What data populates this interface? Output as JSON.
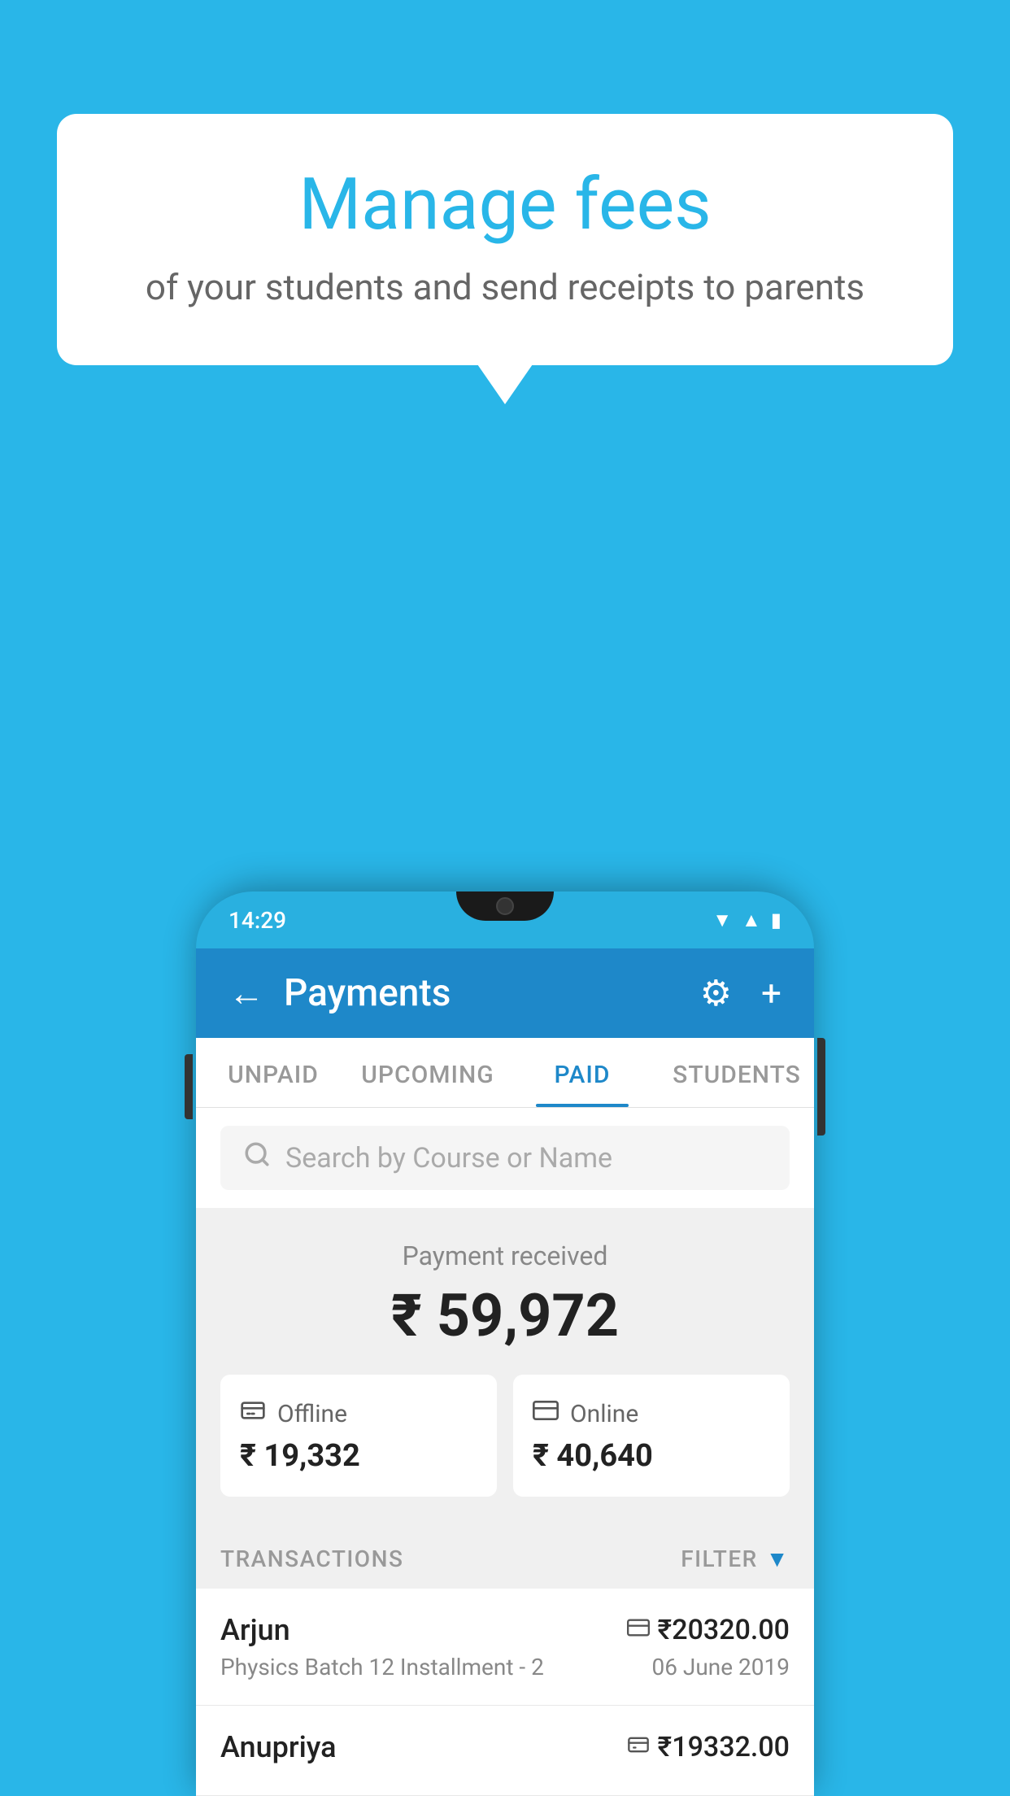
{
  "background_color": "#29b6e8",
  "bubble": {
    "title": "Manage fees",
    "subtitle": "of your students and send receipts to parents"
  },
  "phone": {
    "status_bar": {
      "time": "14:29"
    },
    "header": {
      "title": "Payments",
      "back_label": "←",
      "settings_icon": "⚙",
      "add_icon": "+"
    },
    "tabs": [
      {
        "label": "UNPAID",
        "active": false
      },
      {
        "label": "UPCOMING",
        "active": false
      },
      {
        "label": "PAID",
        "active": true
      },
      {
        "label": "STUDENTS",
        "active": false
      }
    ],
    "search": {
      "placeholder": "Search by Course or Name"
    },
    "payment_summary": {
      "label": "Payment received",
      "total": "₹ 59,972",
      "offline_label": "Offline",
      "offline_amount": "₹ 19,332",
      "online_label": "Online",
      "online_amount": "₹ 40,640"
    },
    "transactions_section": {
      "label": "TRANSACTIONS",
      "filter_label": "FILTER"
    },
    "transactions": [
      {
        "name": "Arjun",
        "course": "Physics Batch 12 Installment - 2",
        "amount": "₹20320.00",
        "date": "06 June 2019",
        "pay_type": "online"
      },
      {
        "name": "Anupriya",
        "course": "",
        "amount": "₹19332.00",
        "date": "",
        "pay_type": "offline"
      }
    ]
  }
}
